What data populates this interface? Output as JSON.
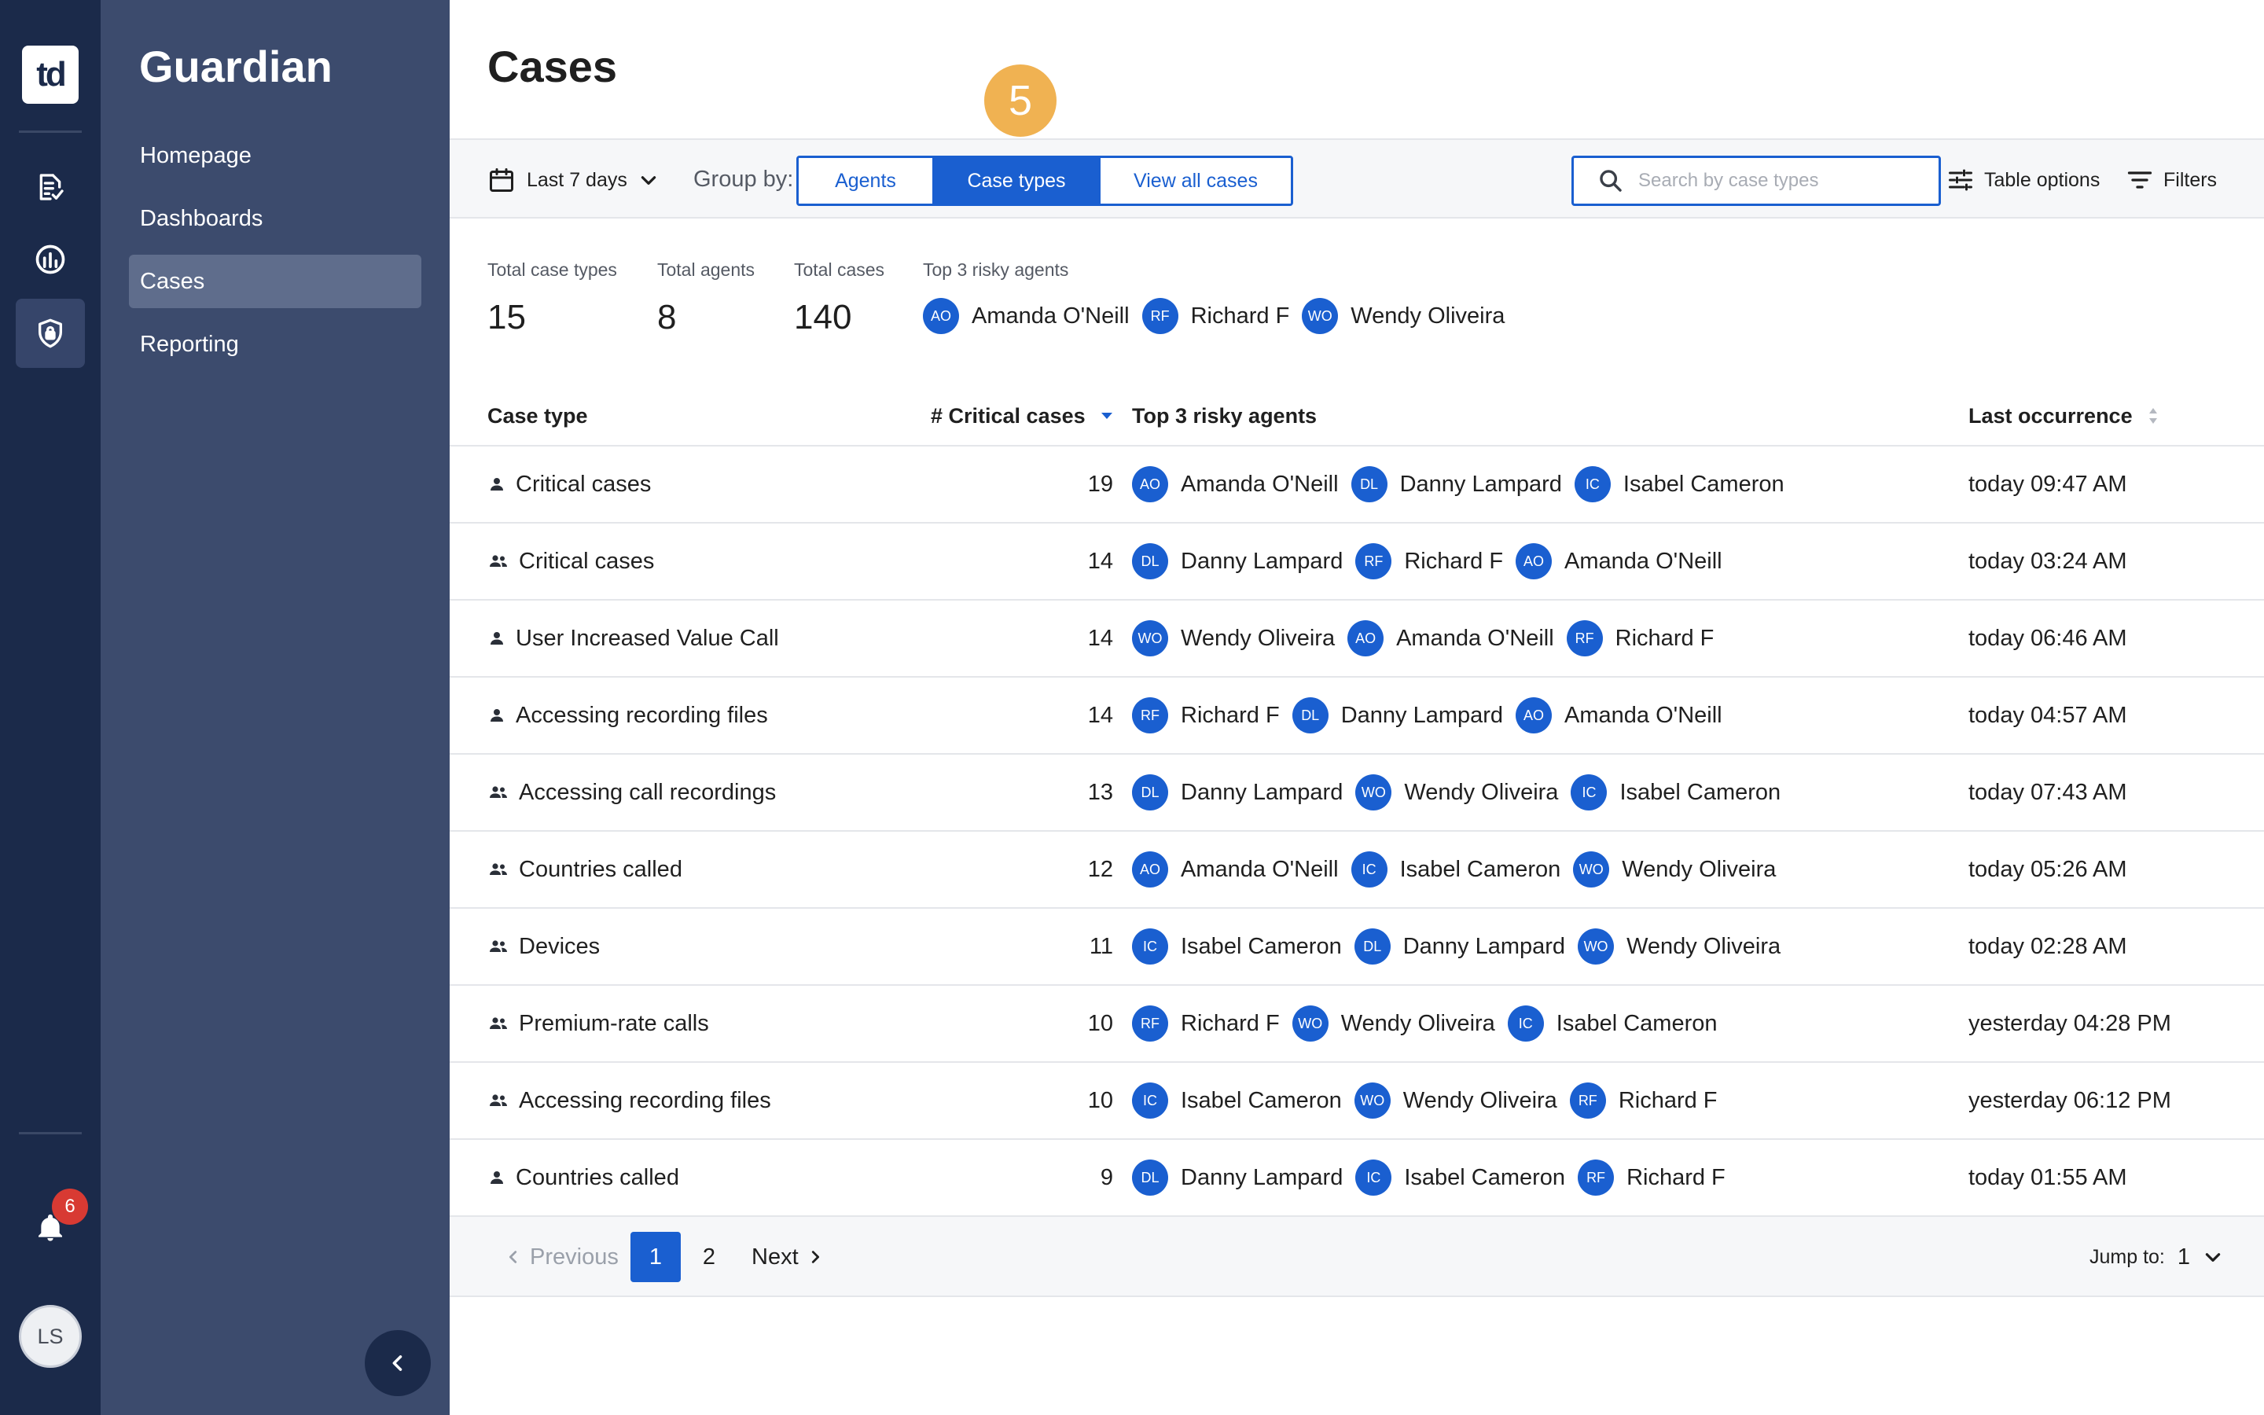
{
  "app": {
    "logo_text": "td",
    "brand": "Guardian",
    "notifications_count": "6",
    "user_initials": "LS"
  },
  "nav": {
    "items": [
      {
        "label": "Homepage",
        "active": false
      },
      {
        "label": "Dashboards",
        "active": false
      },
      {
        "label": "Cases",
        "active": true
      },
      {
        "label": "Reporting",
        "active": false
      }
    ]
  },
  "page": {
    "title": "Cases",
    "step_marker": "5"
  },
  "toolbar": {
    "date_range": "Last 7 days",
    "group_by_label": "Group by:",
    "group_by_options": [
      {
        "label": "Agents",
        "active": false
      },
      {
        "label": "Case types",
        "active": true
      },
      {
        "label": "View all cases",
        "active": false
      }
    ],
    "search_placeholder": "Search by case types",
    "table_options_label": "Table options",
    "filters_label": "Filters"
  },
  "summary": {
    "total_case_types_label": "Total case types",
    "total_case_types": "15",
    "total_agents_label": "Total agents",
    "total_agents": "8",
    "total_cases_label": "Total cases",
    "total_cases": "140",
    "top_agents_label": "Top 3 risky agents",
    "top_agents": [
      {
        "initials": "AO",
        "name": "Amanda O'Neill"
      },
      {
        "initials": "RF",
        "name": "Richard F"
      },
      {
        "initials": "WO",
        "name": "Wendy Oliveira"
      }
    ]
  },
  "table": {
    "columns": {
      "case_type": "Case type",
      "critical_cases": "# Critical cases",
      "top_agents": "Top 3 risky agents",
      "last_occurrence": "Last occurrence"
    },
    "rows": [
      {
        "type_icon": "person-icon",
        "case_type": "Critical cases",
        "count": "19",
        "agents": [
          {
            "initials": "AO",
            "name": "Amanda O'Neill"
          },
          {
            "initials": "DL",
            "name": "Danny Lampard"
          },
          {
            "initials": "IC",
            "name": "Isabel Cameron"
          }
        ],
        "last": "today 09:47 AM"
      },
      {
        "type_icon": "group-icon",
        "case_type": "Critical cases",
        "count": "14",
        "agents": [
          {
            "initials": "DL",
            "name": "Danny Lampard"
          },
          {
            "initials": "RF",
            "name": "Richard F"
          },
          {
            "initials": "AO",
            "name": "Amanda O'Neill"
          }
        ],
        "last": "today 03:24 AM"
      },
      {
        "type_icon": "person-icon",
        "case_type": "User Increased Value Call",
        "count": "14",
        "agents": [
          {
            "initials": "WO",
            "name": "Wendy Oliveira"
          },
          {
            "initials": "AO",
            "name": "Amanda O'Neill"
          },
          {
            "initials": "RF",
            "name": "Richard F"
          }
        ],
        "last": "today 06:46 AM"
      },
      {
        "type_icon": "person-icon",
        "case_type": "Accessing recording files",
        "count": "14",
        "agents": [
          {
            "initials": "RF",
            "name": "Richard F"
          },
          {
            "initials": "DL",
            "name": "Danny Lampard"
          },
          {
            "initials": "AO",
            "name": "Amanda O'Neill"
          }
        ],
        "last": "today 04:57 AM"
      },
      {
        "type_icon": "group-icon",
        "case_type": "Accessing call recordings",
        "count": "13",
        "agents": [
          {
            "initials": "DL",
            "name": "Danny Lampard"
          },
          {
            "initials": "WO",
            "name": "Wendy Oliveira"
          },
          {
            "initials": "IC",
            "name": "Isabel Cameron"
          }
        ],
        "last": "today 07:43 AM"
      },
      {
        "type_icon": "group-icon",
        "case_type": "Countries called",
        "count": "12",
        "agents": [
          {
            "initials": "AO",
            "name": "Amanda O'Neill"
          },
          {
            "initials": "IC",
            "name": "Isabel Cameron"
          },
          {
            "initials": "WO",
            "name": "Wendy Oliveira"
          }
        ],
        "last": "today 05:26 AM"
      },
      {
        "type_icon": "group-icon",
        "case_type": "Devices",
        "count": "11",
        "agents": [
          {
            "initials": "IC",
            "name": "Isabel Cameron"
          },
          {
            "initials": "DL",
            "name": "Danny Lampard"
          },
          {
            "initials": "WO",
            "name": "Wendy Oliveira"
          }
        ],
        "last": "today 02:28 AM"
      },
      {
        "type_icon": "group-icon",
        "case_type": "Premium-rate calls",
        "count": "10",
        "agents": [
          {
            "initials": "RF",
            "name": "Richard F"
          },
          {
            "initials": "WO",
            "name": "Wendy Oliveira"
          },
          {
            "initials": "IC",
            "name": "Isabel Cameron"
          }
        ],
        "last": "yesterday 04:28 PM"
      },
      {
        "type_icon": "group-icon",
        "case_type": "Accessing recording files",
        "count": "10",
        "agents": [
          {
            "initials": "IC",
            "name": "Isabel Cameron"
          },
          {
            "initials": "WO",
            "name": "Wendy Oliveira"
          },
          {
            "initials": "RF",
            "name": "Richard F"
          }
        ],
        "last": "yesterday 06:12 PM"
      },
      {
        "type_icon": "person-icon",
        "case_type": "Countries called",
        "count": "9",
        "agents": [
          {
            "initials": "DL",
            "name": "Danny Lampard"
          },
          {
            "initials": "IC",
            "name": "Isabel Cameron"
          },
          {
            "initials": "RF",
            "name": "Richard F"
          }
        ],
        "last": "today 01:55 AM"
      }
    ]
  },
  "pagination": {
    "previous_label": "Previous",
    "pages": [
      "1",
      "2"
    ],
    "current_page": "1",
    "next_label": "Next",
    "jump_label": "Jump to:",
    "jump_value": "1"
  },
  "colors": {
    "rail_bg": "#1b2a4a",
    "menu_bg": "#3c4b6d",
    "menu_active": "#5f6d8c",
    "accent": "#1a5fd0",
    "step_marker": "#f0b252",
    "badge": "#d83a33"
  }
}
